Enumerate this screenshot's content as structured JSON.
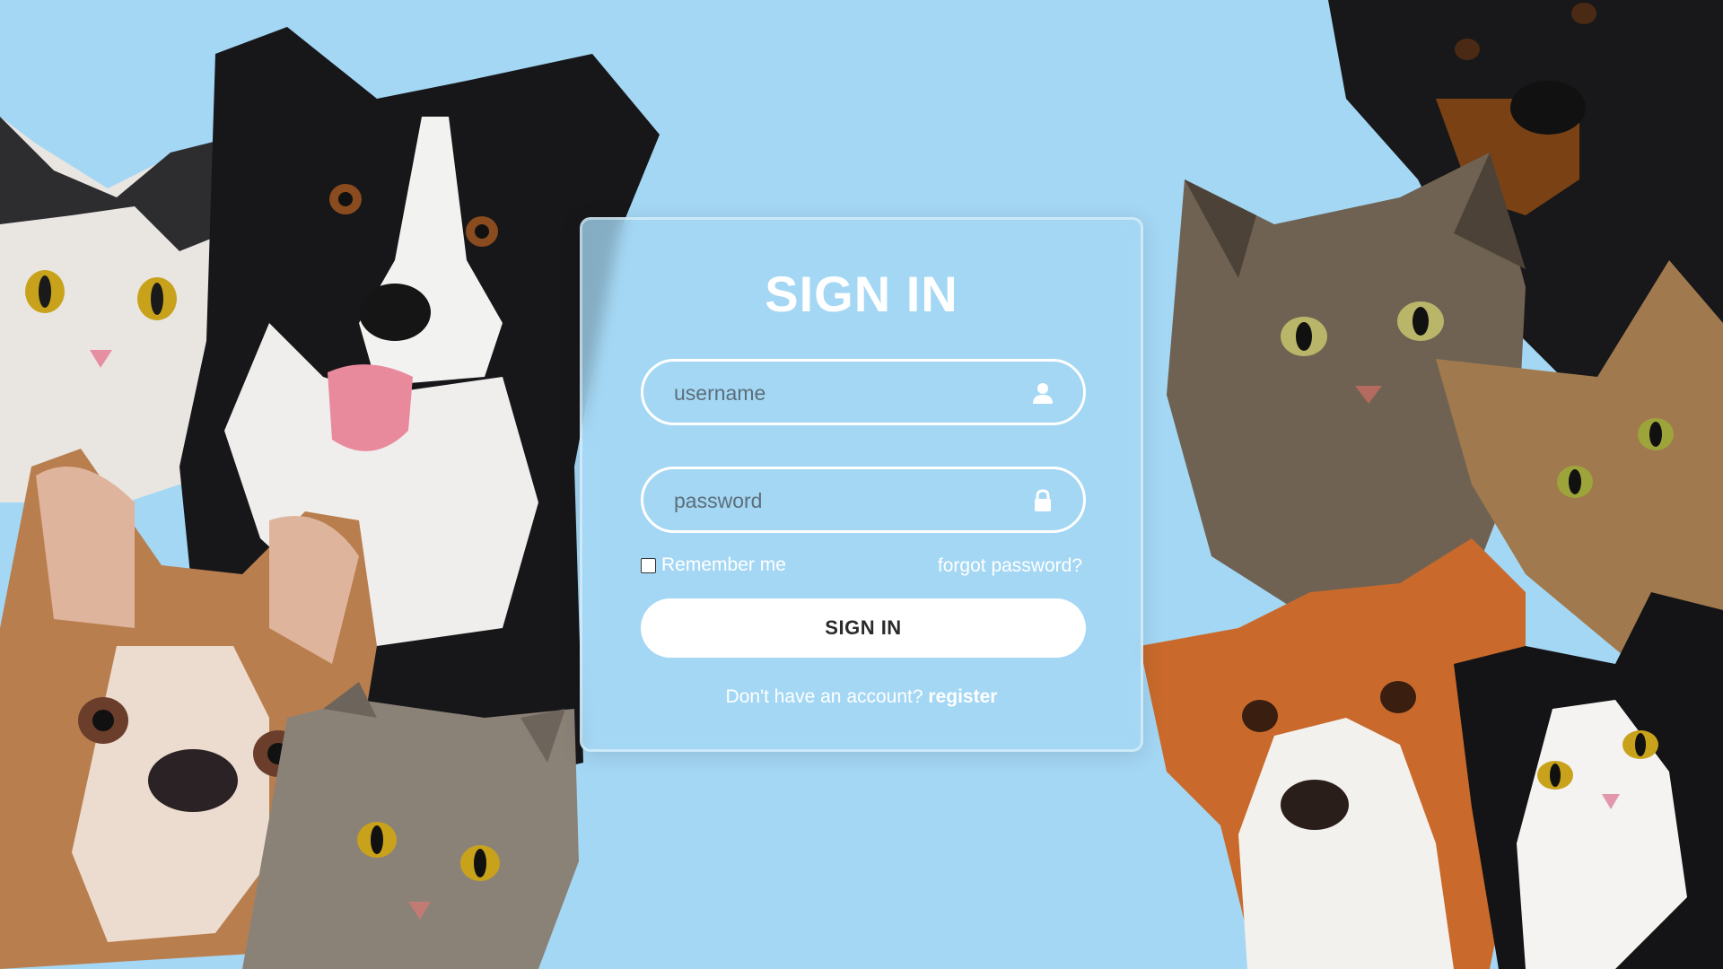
{
  "colors": {
    "background": "#a4d7f4",
    "card_border": "#ffffff",
    "button_bg": "#ffffff",
    "button_text": "#2b2b2b",
    "text": "#ffffff"
  },
  "background_photo": {
    "description_icons": [
      "cat-photo",
      "dog-photo"
    ]
  },
  "login": {
    "title": "SIGN IN",
    "username": {
      "placeholder": "username",
      "value": "",
      "icon": "user-icon"
    },
    "password": {
      "placeholder": "password",
      "value": "",
      "icon": "lock-icon"
    },
    "remember_label": "Remember me",
    "remember_checked": false,
    "forgot_label": "forgot password?",
    "submit_label": "SIGN IN",
    "register_prompt": "Don't have an account?",
    "register_link": "register"
  }
}
